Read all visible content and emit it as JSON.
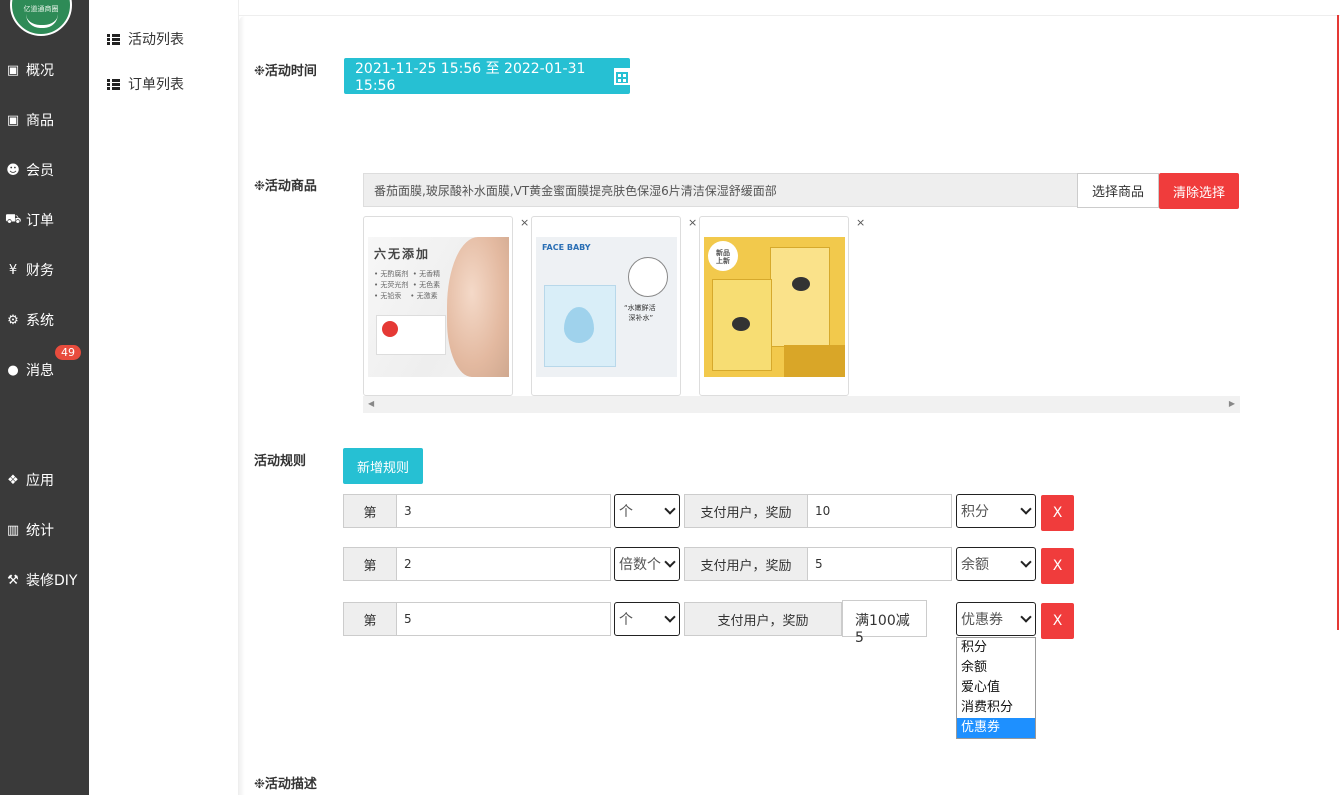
{
  "sidebar": {
    "logo_text": "亿道通商圈",
    "items": [
      {
        "label": "概况",
        "icon": "archive-icon"
      },
      {
        "label": "商品",
        "icon": "archive-icon"
      },
      {
        "label": "会员",
        "icon": "users-icon"
      },
      {
        "label": "订单",
        "icon": "cart-icon"
      },
      {
        "label": "财务",
        "icon": "yen-icon"
      },
      {
        "label": "系统",
        "icon": "gears-icon"
      },
      {
        "label": "消息",
        "icon": "comment-icon"
      },
      {
        "label": "应用",
        "icon": "cubes-icon"
      },
      {
        "label": "统计",
        "icon": "bar-chart-icon"
      },
      {
        "label": "装修DIY",
        "icon": "gavel-icon"
      }
    ],
    "message_badge": "49"
  },
  "submenu": {
    "items": [
      {
        "label": "活动列表"
      },
      {
        "label": "订单列表"
      }
    ]
  },
  "form": {
    "time_label": "❉活动时间",
    "time_range": "2021-11-25 15:56 至 2022-01-31 15:56",
    "goods_label": "❉活动商品",
    "goods_text": "番茄面膜,玻尿酸补水面膜,VT黄金蜜面膜提亮肤色保湿6片清洁保湿舒缓面部",
    "choose_goods": "选择商品",
    "clear_selection": "清除选择",
    "thumbs": [
      {
        "title": "六无添加",
        "lines": "• 无酌腐剂  • 无香精\n• 无荧光剂  • 无色素\n• 无铅汞    • 无激素"
      },
      {
        "brand": "FACE BABY",
        "quote": "“水嫩鲜活\n  深补水”"
      },
      {
        "badge": "新品\n上新"
      }
    ],
    "close_mark": "×",
    "rules_label": "活动规则",
    "add_rule": "新增规则",
    "rules": [
      {
        "prefix": "第",
        "n": "3",
        "unit": "个",
        "middle": "支付用户，奖励",
        "value": "10",
        "type": "积分"
      },
      {
        "prefix": "第",
        "n": "2",
        "unit": "倍数个",
        "middle": "支付用户，奖励",
        "value": "5",
        "type": "余额"
      },
      {
        "prefix": "第",
        "n": "5",
        "unit": "个",
        "middle": "支付用户，奖励",
        "value": "满100减5",
        "type": "优惠券"
      }
    ],
    "remove": "X",
    "dropdown_options": [
      "积分",
      "余额",
      "爱心值",
      "消费积分",
      "优惠券"
    ],
    "desc_label": "❉活动描述"
  }
}
